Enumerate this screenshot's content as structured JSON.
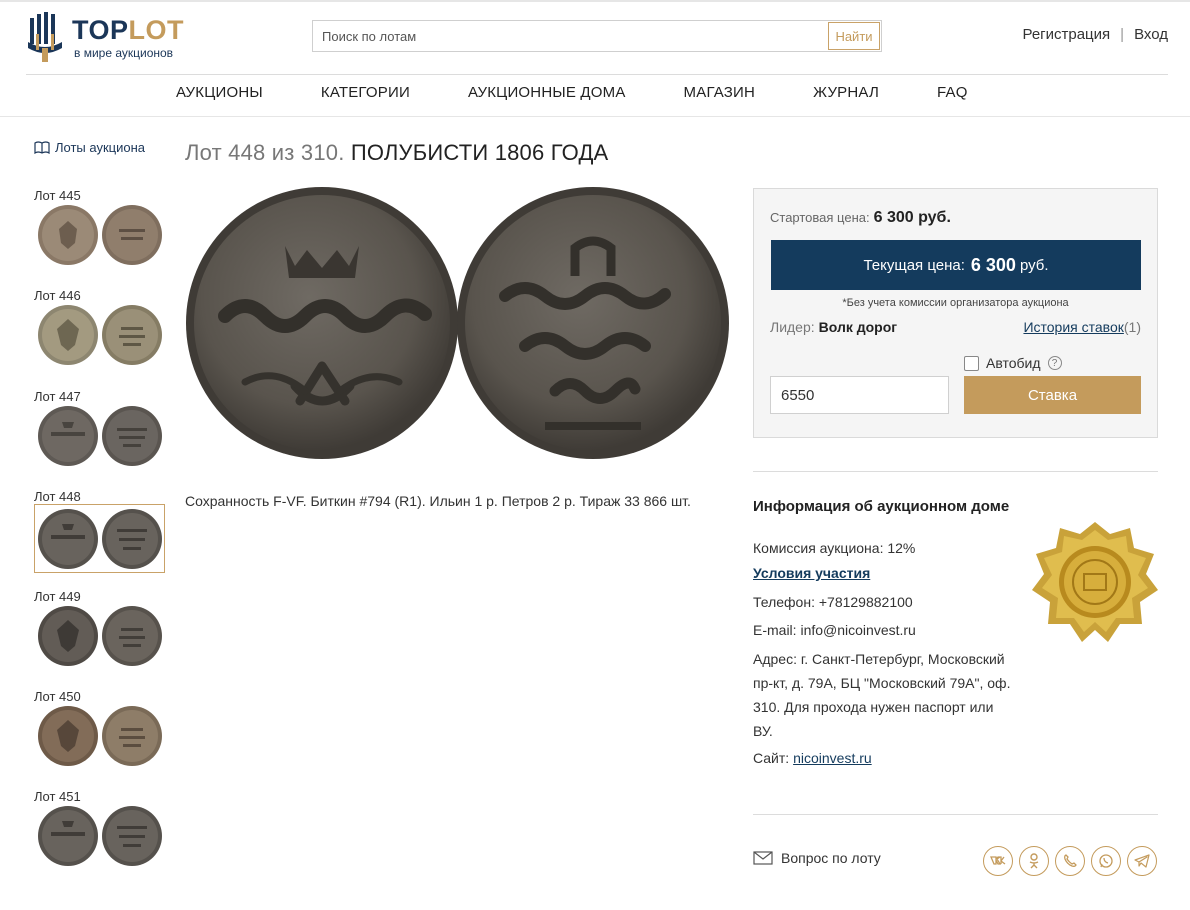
{
  "header": {
    "logo_main": "TOP",
    "logo_accent": "LOT",
    "logo_tagline": "в мире аукционов",
    "search_placeholder": "Поиск по лотам",
    "search_button": "Найти",
    "register": "Регистрация",
    "separator": "|",
    "login": "Вход"
  },
  "nav": [
    "АУКЦИОНЫ",
    "КАТЕГОРИИ",
    "АУКЦИОННЫЕ ДОМА",
    "МАГАЗИН",
    "ЖУРНАЛ",
    "FAQ"
  ],
  "sidebar": {
    "lots_link": "Лоты аукциона",
    "lots": [
      {
        "label": "Лот 445",
        "active": false
      },
      {
        "label": "Лот 446",
        "active": false
      },
      {
        "label": "Лот 447",
        "active": false
      },
      {
        "label": "Лот 448",
        "active": true
      },
      {
        "label": "Лот 449",
        "active": false
      },
      {
        "label": "Лот 450",
        "active": false
      },
      {
        "label": "Лот 451",
        "active": false
      }
    ]
  },
  "lot": {
    "title_prefix": "Лот 448 из 310.",
    "title_name": "ПОЛУБИСТИ 1806 ГОДА",
    "description": "Сохранность F-VF. Биткин #794 (R1). Ильин 1 р. Петров 2 р. Тираж 33 866 шт."
  },
  "bid": {
    "start_label": "Стартовая цена:",
    "start_value": "6 300 руб.",
    "current_label": "Текущая цена:",
    "current_value": "6 300",
    "current_unit": "руб.",
    "note": "*Без учета комиссии организатора аукциона",
    "leader_label": "Лидер:",
    "leader_value": "Волк дорог",
    "history_label": "История ставок",
    "history_count": "(1)",
    "autobid_label": "Автобид",
    "help_glyph": "?",
    "input_value": "6550",
    "bid_button": "Ставка"
  },
  "house": {
    "title": "Информация об аукционном доме",
    "commission": "Комиссия аукциона: 12%",
    "terms": "Условия участия",
    "phone_label": "Телефон:",
    "phone": "+78129882100",
    "email_label": "E-mail:",
    "email": "info@nicoinvest.ru",
    "address": "Адрес: г. Санкт-Петербург, Московский пр-кт, д. 79А, БЦ \"Московский 79А\", оф. 310. Для прохода нужен паспорт или ВУ.",
    "site_label": "Сайт:",
    "site": "nicoinvest.ru"
  },
  "footer": {
    "question": "Вопрос по лоту",
    "socials": [
      "vk-icon",
      "odnoklassniki-icon",
      "viber-icon",
      "whatsapp-icon",
      "telegram-icon"
    ]
  },
  "colors": {
    "navy": "#143b5d",
    "gold": "#c49b5c",
    "coin_dark": "#5a544c"
  }
}
